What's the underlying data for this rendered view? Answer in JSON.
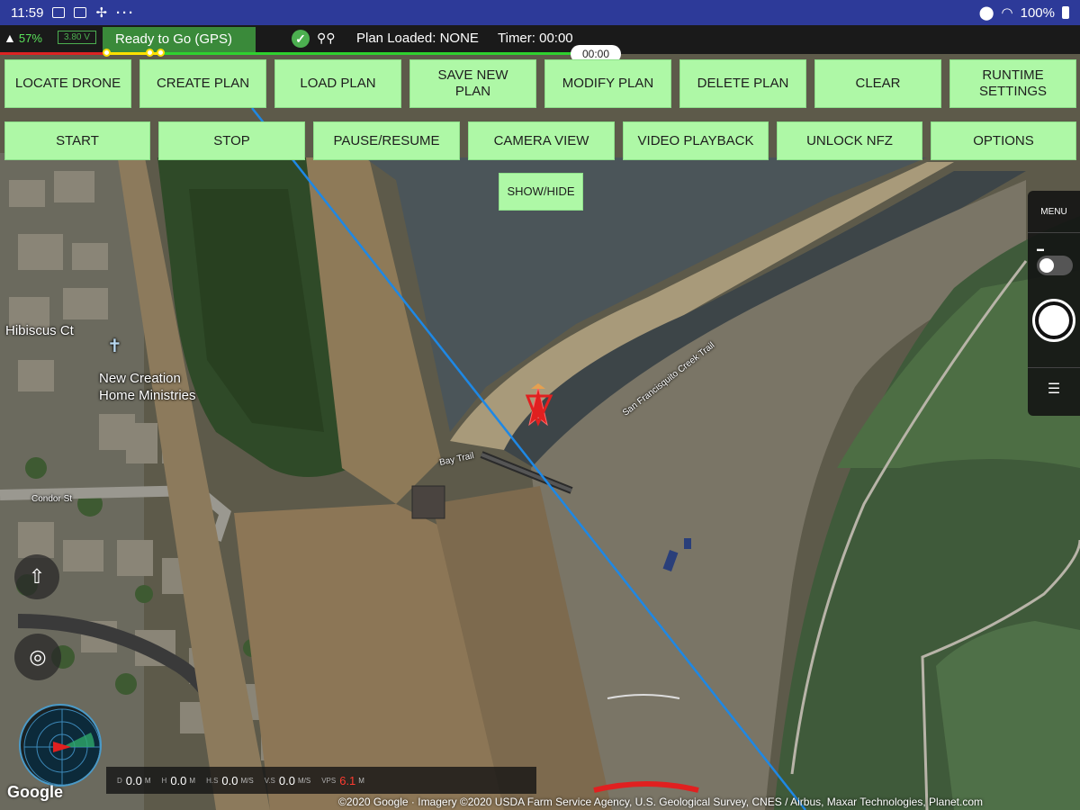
{
  "android_status": {
    "time": "11:59",
    "dots": "···",
    "battery_percent": "100%"
  },
  "telemetry": {
    "battery": "57%",
    "voltage": "3.80 V",
    "status": "Ready to Go (GPS)",
    "plan_loaded": "Plan Loaded: NONE",
    "timer": "Timer: 00:00",
    "timer_pill": "00:00",
    "status_ok_glyph": "✓"
  },
  "buttons_row1": [
    "LOCATE DRONE",
    "CREATE PLAN",
    "LOAD PLAN",
    "SAVE NEW PLAN",
    "MODIFY PLAN",
    "DELETE PLAN",
    "CLEAR",
    "RUNTIME SETTINGS"
  ],
  "buttons_row2": [
    "START",
    "STOP",
    "PAUSE/RESUME",
    "CAMERA VIEW",
    "VIDEO PLAYBACK",
    "UNLOCK NFZ",
    "OPTIONS"
  ],
  "show_hide": "SHOW/HIDE",
  "camera_panel": {
    "menu": "MENU",
    "mode_icon": "▬",
    "settings_glyph": "☰"
  },
  "map_labels": {
    "hibiscus": "Hibiscus Ct",
    "ministries_line1": "New Creation",
    "ministries_line2": "Home Ministries",
    "condor": "Condor St",
    "bay_trail": "Bay Trail",
    "creek_trail": "San Francisquito Creek Trail",
    "anchor_icon": "✝"
  },
  "bottom_telemetry": {
    "d_label": "D",
    "d_value": "0.0",
    "d_unit": "M",
    "h_label": "H",
    "h_value": "0.0",
    "h_unit": "M",
    "hs_label": "H.S",
    "hs_value": "0.0",
    "hs_unit": "M/S",
    "vs_label": "V.S",
    "vs_value": "0.0",
    "vs_unit": "M/S",
    "vps_label": "VPS",
    "vps_value": "6.1",
    "vps_unit": "M"
  },
  "google_logo": "Google",
  "attribution": "©2020 Google · Imagery ©2020 USDA Farm Service Agency, U.S. Geological Survey, CNES / Airbus, Maxar Technologies, Planet.com",
  "icons": {
    "home_upload": "⇧",
    "compass": "◎"
  },
  "colors": {
    "button_bg": "#aef8a6",
    "android_bar": "#2d3a99",
    "telemetry_bg": "#1a1a1a",
    "ready_green": "#3a8a3a",
    "flight_line": "#1e88e5"
  }
}
